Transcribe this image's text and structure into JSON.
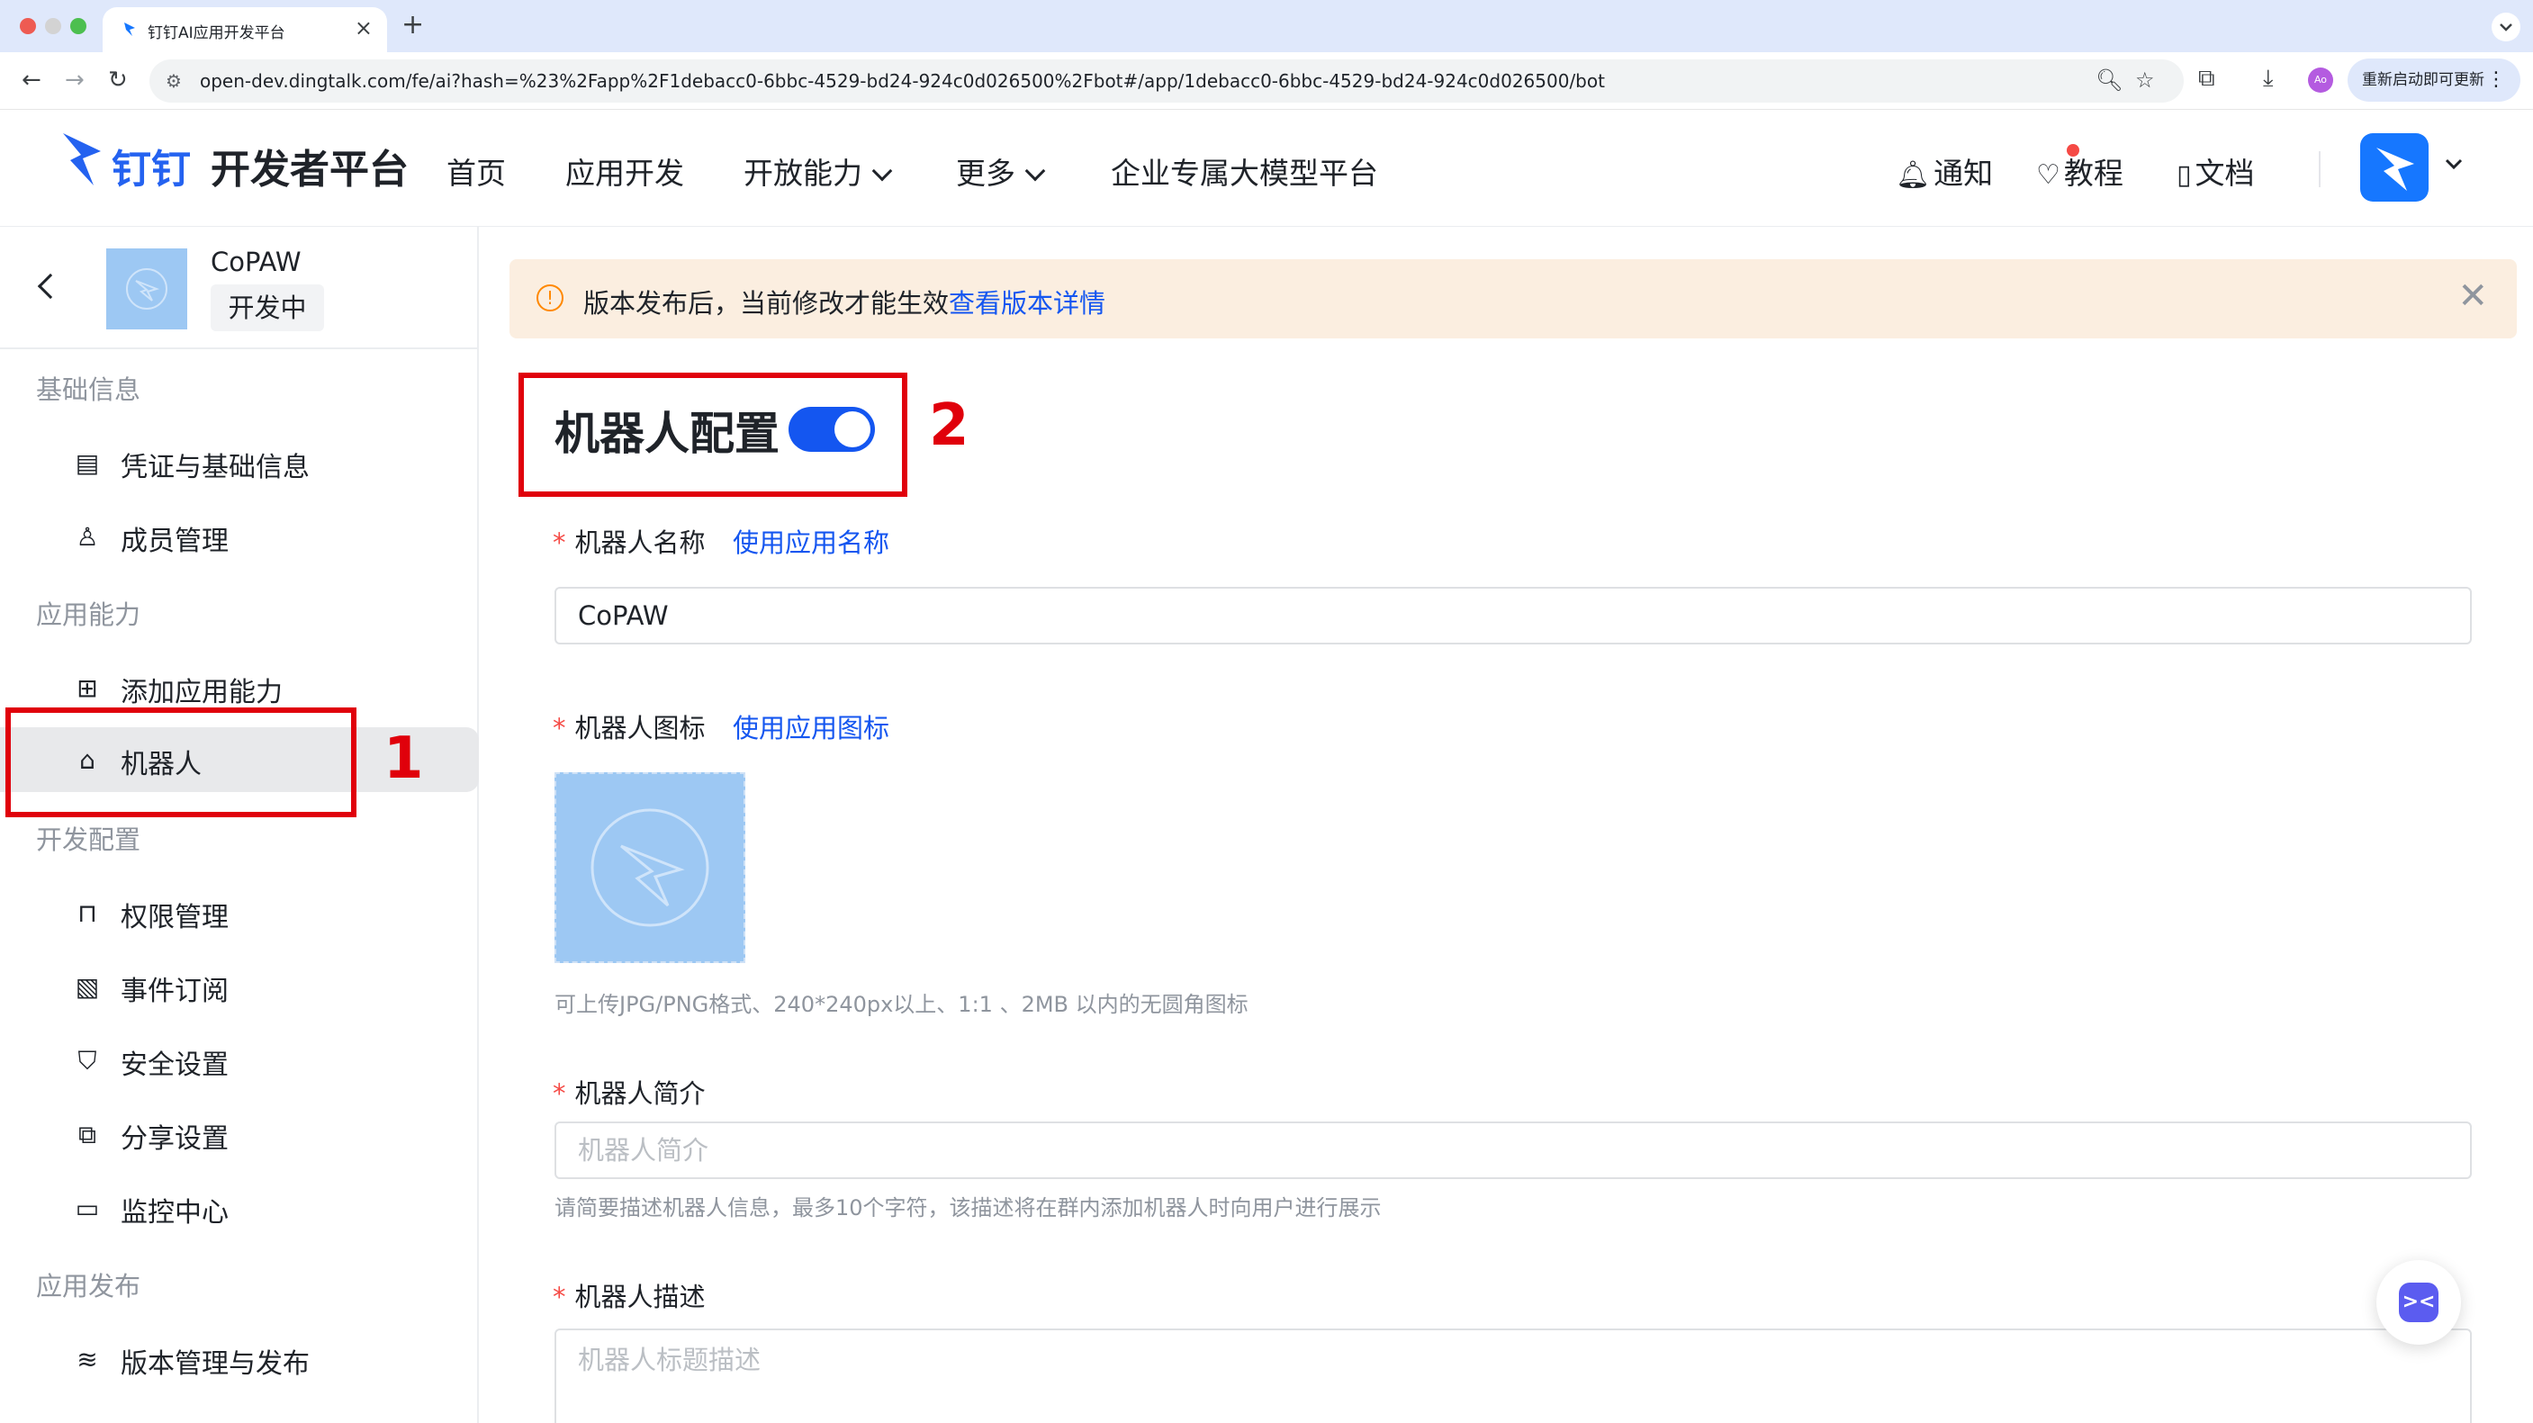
{
  "browser": {
    "tab_title": "钉钉AI应用开发平台",
    "tab_close": "×",
    "new_tab": "+",
    "url": "open-dev.dingtalk.com/fe/ai?hash=%23%2Fapp%2F1debacc0-6bbc-4529-bd24-924c0d026500%2Fbot#/app/1debacc0-6bbc-4529-bd24-924c0d026500/bot",
    "relaunch_label": "重新启动即可更新",
    "profile_initials": "Ao"
  },
  "header": {
    "logo_brand": "钉钉",
    "logo_subtitle": "开发者平台",
    "nav": [
      {
        "label": "首页"
      },
      {
        "label": "应用开发"
      },
      {
        "label": "开放能力"
      },
      {
        "label": "更多"
      },
      {
        "label": "企业专属大模型平台"
      }
    ],
    "utils": {
      "notify": "通知",
      "tutorial": "教程",
      "docs": "文档"
    }
  },
  "sidebar": {
    "app_name": "CoPAW",
    "app_status": "开发中",
    "groups": [
      {
        "label": "基础信息",
        "items": [
          {
            "label": "凭证与基础信息"
          },
          {
            "label": "成员管理"
          }
        ]
      },
      {
        "label": "应用能力",
        "items": [
          {
            "label": "添加应用能力"
          },
          {
            "label": "机器人"
          }
        ]
      },
      {
        "label": "开发配置",
        "items": [
          {
            "label": "权限管理"
          },
          {
            "label": "事件订阅"
          },
          {
            "label": "安全设置"
          },
          {
            "label": "分享设置"
          },
          {
            "label": "监控中心"
          }
        ]
      },
      {
        "label": "应用发布",
        "items": [
          {
            "label": "版本管理与发布"
          }
        ]
      }
    ]
  },
  "banner": {
    "text": "版本发布后，当前修改才能生效",
    "link": "查看版本详情"
  },
  "bot_config": {
    "title": "机器人配置",
    "enabled": true,
    "name_label": "机器人名称",
    "name_link": "使用应用名称",
    "name_value": "CoPAW",
    "icon_label": "机器人图标",
    "icon_link": "使用应用图标",
    "icon_hint": "可上传JPG/PNG格式、240*240px以上、1:1 、2MB 以内的无圆角图标",
    "intro_label": "机器人简介",
    "intro_placeholder": "机器人简介",
    "intro_hint": "请简要描述机器人信息，最多10个字符，该描述将在群内添加机器人时向用户进行展示",
    "desc_label": "机器人描述",
    "desc_placeholder": "机器人标题描述"
  },
  "annotations": {
    "one": "1",
    "two": "2"
  },
  "colors": {
    "accent": "#1456f0",
    "annotation_red": "#e0000b",
    "banner_bg": "#fbeee0"
  }
}
